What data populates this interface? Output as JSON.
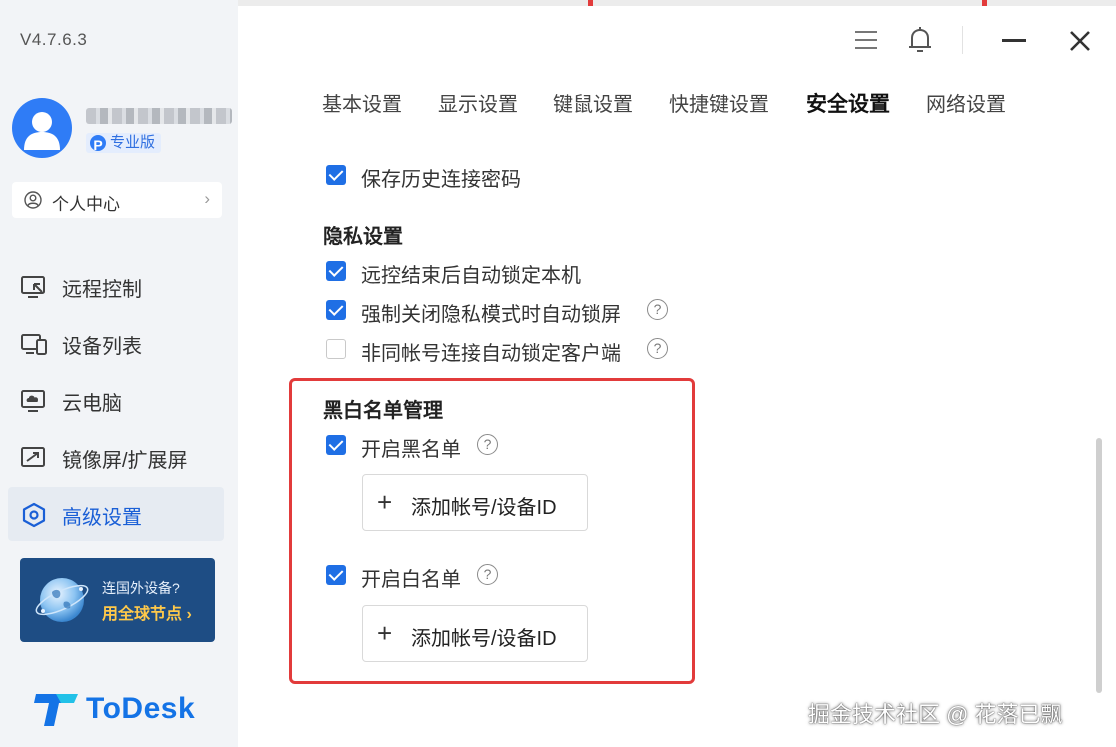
{
  "app": {
    "version": "V4.7.6.3",
    "brand_name": "ToDesk",
    "accent_color": "#1f6fe5",
    "highlight_color": "#e23b3b"
  },
  "user": {
    "pro_badge_letter": "P",
    "pro_badge_text": "专业版"
  },
  "sidebar": {
    "personal_center": "个人中心",
    "items": [
      {
        "label": "远程控制",
        "icon": "remote-control-icon",
        "active": false
      },
      {
        "label": "设备列表",
        "icon": "device-list-icon",
        "active": false
      },
      {
        "label": "云电脑",
        "icon": "cloud-pc-icon",
        "active": false
      },
      {
        "label": "镜像屏/扩展屏",
        "icon": "mirror-screen-icon",
        "active": false
      },
      {
        "label": "高级设置",
        "icon": "advanced-settings-icon",
        "active": true
      }
    ],
    "promo": {
      "line1": "连国外设备?",
      "line2": "用全球节点 ›"
    }
  },
  "window_controls": {
    "menu_icon": "menu-icon",
    "bell_icon": "bell-icon",
    "minimize_icon": "minimize-icon",
    "close_icon": "close-icon"
  },
  "tabs": [
    {
      "label": "基本设置",
      "active": false
    },
    {
      "label": "显示设置",
      "active": false
    },
    {
      "label": "键鼠设置",
      "active": false
    },
    {
      "label": "快捷键设置",
      "active": false
    },
    {
      "label": "安全设置",
      "active": true
    },
    {
      "label": "网络设置",
      "active": false
    }
  ],
  "settings": {
    "save_password": {
      "label": "保存历史连接密码",
      "checked": true
    },
    "privacy": {
      "title": "隐私设置",
      "options": [
        {
          "label": "远控结束后自动锁定本机",
          "checked": true,
          "help": false
        },
        {
          "label": "强制关闭隐私模式时自动锁屏",
          "checked": true,
          "help": true
        },
        {
          "label": "非同帐号连接自动锁定客户端",
          "checked": false,
          "help": true
        }
      ]
    },
    "list_management": {
      "title": "黑白名单管理",
      "blacklist": {
        "label": "开启黑名单",
        "checked": true,
        "add_label": "添加帐号/设备ID"
      },
      "whitelist": {
        "label": "开启白名单",
        "checked": true,
        "add_label": "添加帐号/设备ID"
      }
    },
    "help_glyph": "?"
  },
  "watermark": "掘金技术社区 @ 花落已飘"
}
